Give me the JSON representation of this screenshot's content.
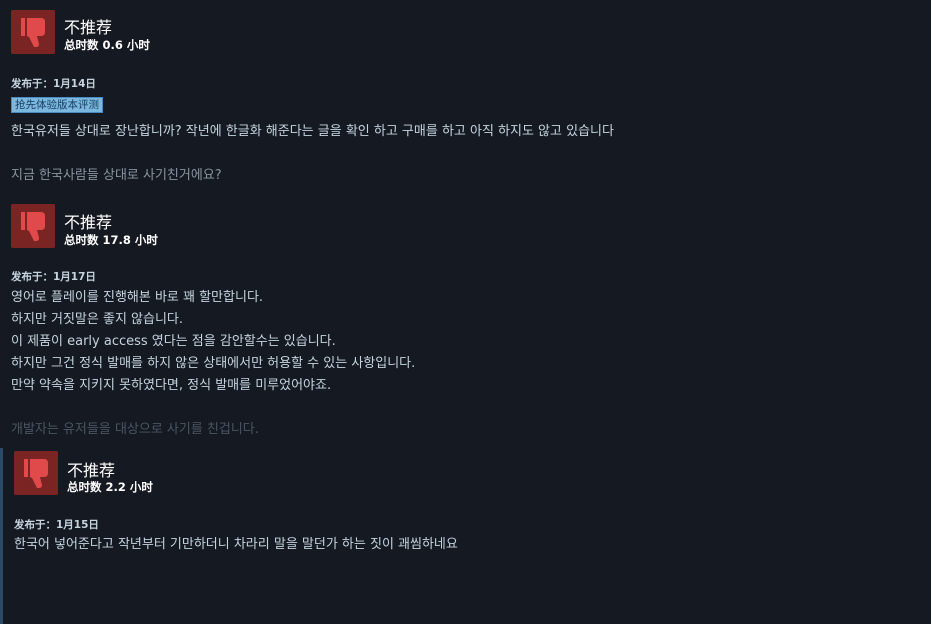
{
  "colors": {
    "background": "#151a22",
    "thumb_bg": "#7a2424",
    "thumb_icon": "#e04a4a",
    "badge_bg": "#7ab8e0",
    "text": "#c6d4df",
    "accent_bar": "#2a4a66"
  },
  "reviews": [
    {
      "icon": "thumbs-down-icon",
      "verdict": "不推荐",
      "hours": "总时数 0.6 小时",
      "posted": "发布于：1月14日",
      "badge": "抢先体验版本评测",
      "lines": [
        "한국유저들 상대로 장난합니까? 작년에 한글화 해준다는 글을 확인 하고 구매를 하고 아직 하지도 않고 있습니다",
        "",
        "지금 한국사람들 상대로 사기친거에요?"
      ]
    },
    {
      "icon": "thumbs-down-icon",
      "verdict": "不推荐",
      "hours": "总时数 17.8 小时",
      "posted": "发布于：1月17日",
      "lines": [
        "영어로 플레이를 진행해본 바로 꽤 할만합니다.",
        "하지만 거짓말은 좋지 않습니다.",
        "이 제품이 early access 였다는 점을 감안할수는 있습니다.",
        "하지만 그건 정식 발매를 하지 않은 상태에서만 허용할 수 있는 사항입니다.",
        "만약 약속을 지키지 못하였다면, 정식 발매를 미루었어야죠.",
        "",
        "개발자는 유저들을 대상으로 사기를 친겁니다."
      ]
    },
    {
      "icon": "thumbs-down-icon",
      "verdict": "不推荐",
      "hours": "总时数 2.2 小时",
      "posted": "发布于：1月15日",
      "lines": [
        "한국어 넣어준다고 작년부터 기만하더니 차라리 말을 말던가 하는 짓이 괘씸하네요"
      ]
    }
  ]
}
